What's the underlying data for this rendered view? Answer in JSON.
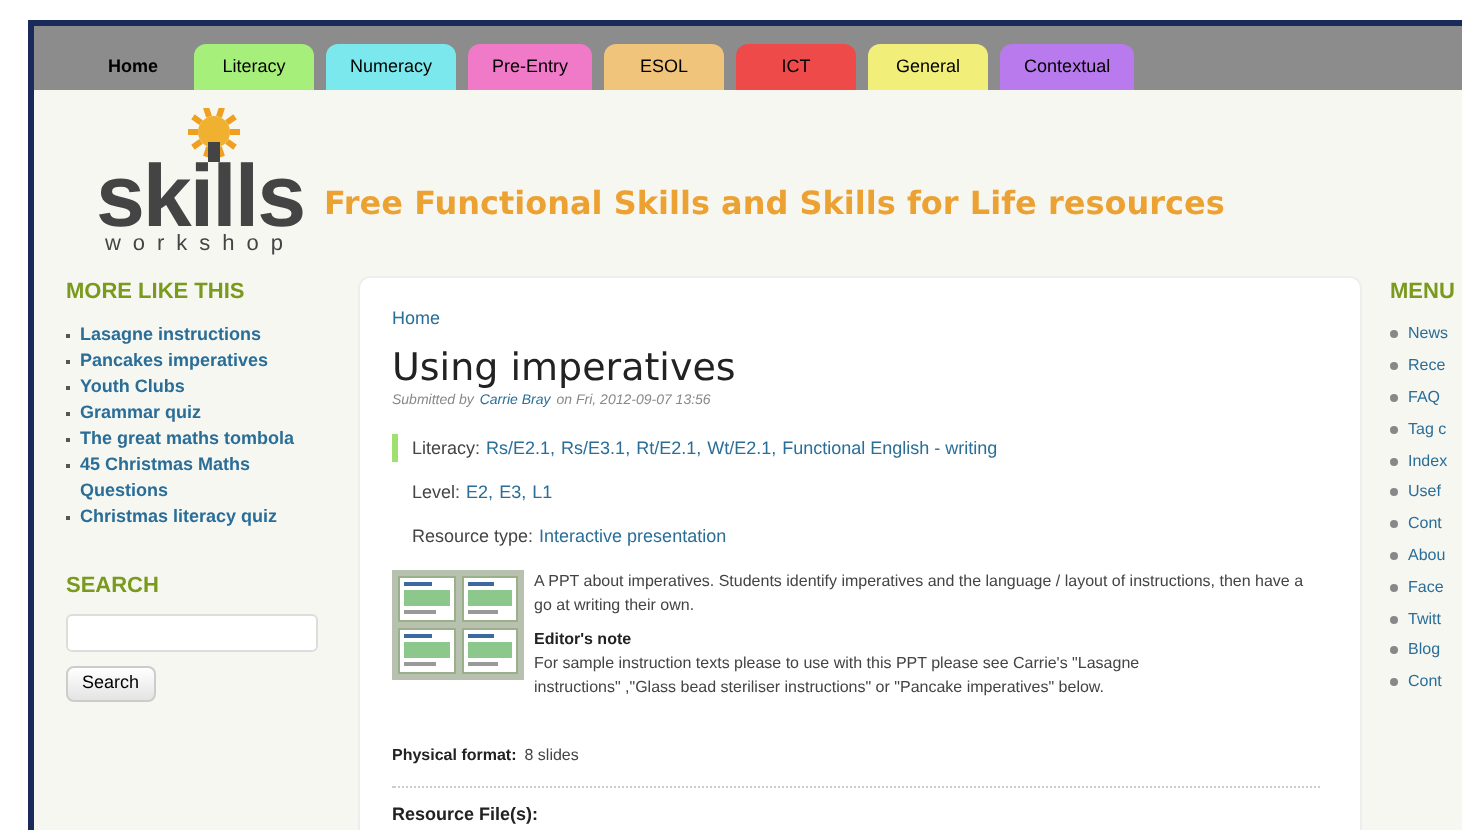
{
  "nav_tabs": [
    {
      "label": "Home",
      "color": "#8c8c8c",
      "selected": true
    },
    {
      "label": "Literacy",
      "color": "#a6ef7a",
      "selected": false
    },
    {
      "label": "Numeracy",
      "color": "#7ae8ec",
      "selected": false
    },
    {
      "label": "Pre-Entry",
      "color": "#f07ac8",
      "selected": false
    },
    {
      "label": "ESOL",
      "color": "#f0c47a",
      "selected": false
    },
    {
      "label": "ICT",
      "color": "#ee4a4a",
      "selected": false
    },
    {
      "label": "General",
      "color": "#f2ee7a",
      "selected": false
    },
    {
      "label": "Contextual",
      "color": "#b87aec",
      "selected": false
    }
  ],
  "logo": {
    "word": "skills",
    "subword": "workshop"
  },
  "tagline": "Free Functional Skills and Skills for Life resources",
  "more_like_this": {
    "heading": "MORE LIKE THIS",
    "items": [
      "Lasagne instructions",
      "Pancakes imperatives",
      "Youth Clubs",
      "Grammar quiz",
      "The great maths tombola",
      "45 Christmas Maths Questions",
      "Christmas literacy quiz"
    ]
  },
  "search": {
    "heading": "SEARCH",
    "button": "Search"
  },
  "article": {
    "breadcrumb": "Home",
    "title": "Using imperatives",
    "submitted": {
      "prefix": "Submitted by",
      "author": "Carrie Bray",
      "suffix": "on Fri, 2012-09-07 13:56"
    },
    "separator": ",",
    "fields": [
      {
        "label": "Literacy:",
        "links": [
          "Rs/E2.1",
          "Rs/E3.1",
          "Rt/E2.1",
          "Wt/E2.1",
          "Functional English - writing"
        ],
        "marked": true
      },
      {
        "label": "Level:",
        "links": [
          "E2",
          "E3",
          "L1"
        ],
        "marked": false
      },
      {
        "label": "Resource type:",
        "links": [
          "Interactive presentation"
        ],
        "marked": false
      }
    ],
    "description": "A PPT about imperatives. Students identify imperatives and the language / layout of instructions, then have a go at writing their own.",
    "editors_note": {
      "heading": "Editor's note",
      "text": "For sample instruction texts please to use with this PPT please see Carrie's \"Lasagne instructions\" ,\"Glass bead steriliser instructions\" or \"Pancake imperatives\" below."
    },
    "physical_format": {
      "label": "Physical format:",
      "value": "8 slides"
    },
    "resource_files": "Resource File(s):"
  },
  "menu": {
    "heading": "MENU",
    "items": [
      "News",
      "Rece",
      "FAQ",
      "Tag c",
      "Index",
      "Usef",
      "Cont",
      "Abou",
      "Face",
      "Twitt",
      "Blog",
      "Cont"
    ]
  }
}
